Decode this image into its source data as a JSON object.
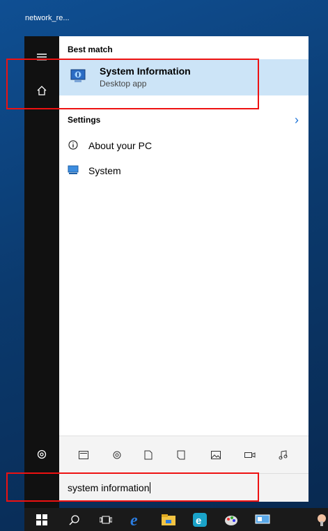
{
  "desktop": {
    "label": "network_re..."
  },
  "panel": {
    "best_match_header": "Best match",
    "best_match": {
      "title": "System Information",
      "subtitle": "Desktop app"
    },
    "settings_header": "Settings",
    "settings_items": [
      {
        "label": "About your PC",
        "icon": "info-icon"
      },
      {
        "label": "System",
        "icon": "monitor-icon"
      }
    ]
  },
  "filters": [
    "apps-icon",
    "settings-icon",
    "documents-icon",
    "folders-icon",
    "photos-icon",
    "videos-icon",
    "music-icon"
  ],
  "search": {
    "value": "system information"
  },
  "taskbar": [
    "start-icon",
    "search-icon",
    "task-view-icon",
    "edge-icon",
    "file-explorer-icon",
    "e-app-icon",
    "paint-icon",
    "screen-icon",
    "settings-app-icon"
  ],
  "colors": {
    "highlight": "#cce4f7",
    "accent": "#1e74d8",
    "annotation": "#ee1111"
  }
}
